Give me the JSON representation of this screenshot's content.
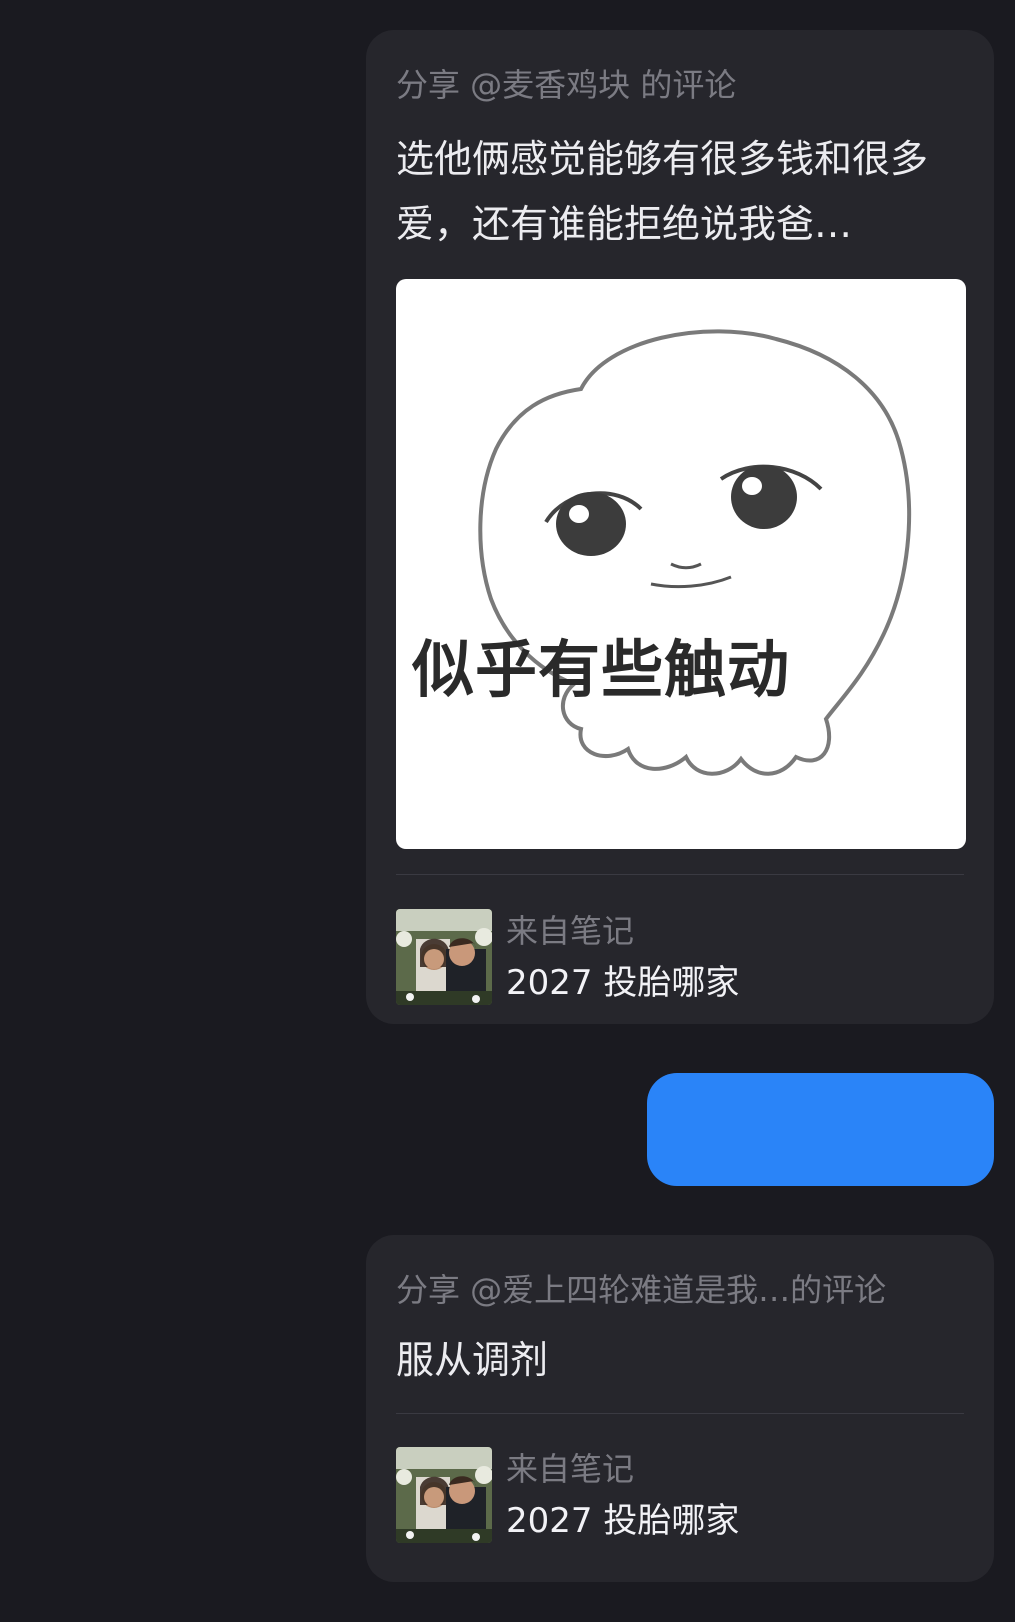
{
  "messages": {
    "first": {
      "share_prefix": "分享 @麦香鸡块 的评论",
      "comment": "选他俩感觉能够有很多钱和很多爱，还有谁能拒绝说我爸…",
      "sticker_caption": "似乎有些触动",
      "note_label": "来自笔记",
      "note_title": "2027 投胎哪家"
    },
    "bubble": {
      "text": "",
      "color": "#2a84f8"
    },
    "second": {
      "share_prefix": "分享 @爱上四轮难道是我…的评论",
      "comment": "服从调剂",
      "note_label": "来自笔记",
      "note_title": "2027 投胎哪家"
    }
  },
  "icons": {
    "note_thumbnail": "wedding-photo-thumbnail",
    "sticker": "ghost-face-sticker"
  },
  "colors": {
    "background": "#1a1a20",
    "card": "#26262c",
    "muted_text": "#7b7b83",
    "accent": "#2a84f8"
  }
}
